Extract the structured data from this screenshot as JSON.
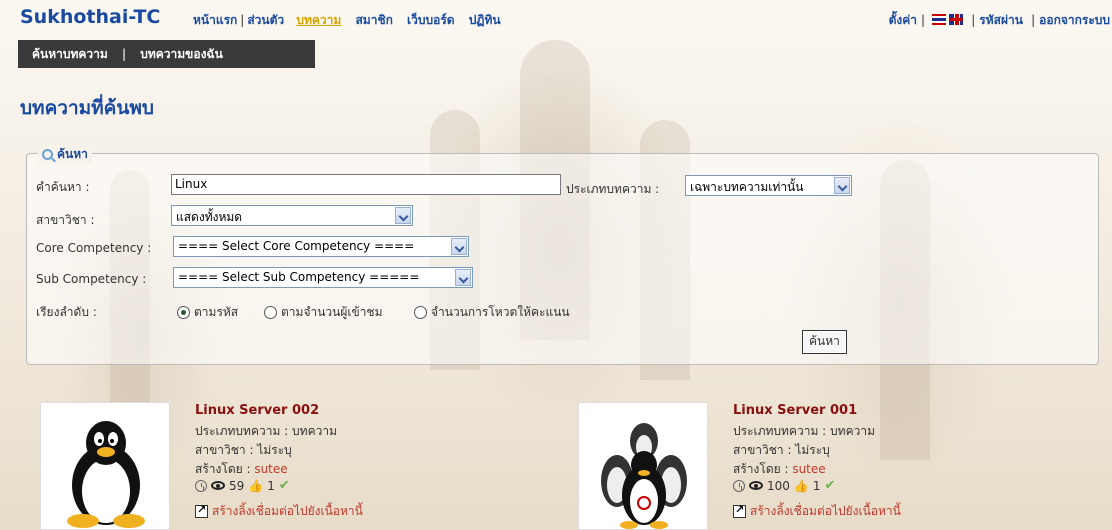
{
  "header": {
    "brand": "Sukhothai-TC",
    "nav": [
      "หน้าแรก",
      "ส่วนตัว",
      "บทความ",
      "สมาชิก",
      "เว็บบอร์ด",
      "ปฏิทิน"
    ],
    "active_nav": "บทความ",
    "right_nav": {
      "settings": "ตั้งค่า",
      "password": "รหัสผ่าน",
      "logout": "ออกจากระบบ"
    }
  },
  "subnav": {
    "search_articles": "ค้นหาบทความ",
    "my_articles": "บทความของฉัน"
  },
  "page_title": "บทความที่ค้นพบ",
  "search": {
    "legend": "ค้นหา",
    "keyword_label": "คำค้นหา :",
    "keyword_value": "Linux",
    "type_label": "ประเภทบทความ :",
    "type_value": "เฉพาะบทความเท่านั้น",
    "subject_label": "สาขาวิชา :",
    "subject_value": "แสดงทั้งหมด",
    "core_label": "Core Competency :",
    "core_value": "==== Select Core Competency ====",
    "sub_label": "Sub Competency :",
    "sub_value": "==== Select Sub Competency =====",
    "sort_label": "เรียงลำดับ :",
    "sort_options": [
      "ตามรหัส",
      "ตามจำนวนผู้เข้าชม",
      "จำนวนการโหวตให้คะแนน"
    ],
    "sort_selected": "ตามรหัส",
    "submit_label": "ค้นหา"
  },
  "results": [
    {
      "title": "Linux Server 002",
      "type_line": "ประเภทบทความ : บทความ",
      "subject_line": "สาขาวิชา : ไม่ระบุ",
      "created_prefix": "สร้างโดย : ",
      "created_by": "sutee",
      "views": "59",
      "likes": "1",
      "link_text": "สร้างลิ้งเชื่อมต่อไปยังเนื้อหานี้"
    },
    {
      "title": "Linux Server 001",
      "type_line": "ประเภทบทความ : บทความ",
      "subject_line": "สาขาวิชา : ไม่ระบุ",
      "created_prefix": "สร้างโดย : ",
      "created_by": "sutee",
      "views": "100",
      "likes": "1",
      "link_text": "สร้างลิ้งเชื่อมต่อไปยังเนื้อหานี้"
    }
  ],
  "colors": {
    "brand": "#1a4aa0",
    "active_nav": "#d4a400",
    "title_red": "#8a1010",
    "subnav_bg": "#3a3a3a"
  }
}
